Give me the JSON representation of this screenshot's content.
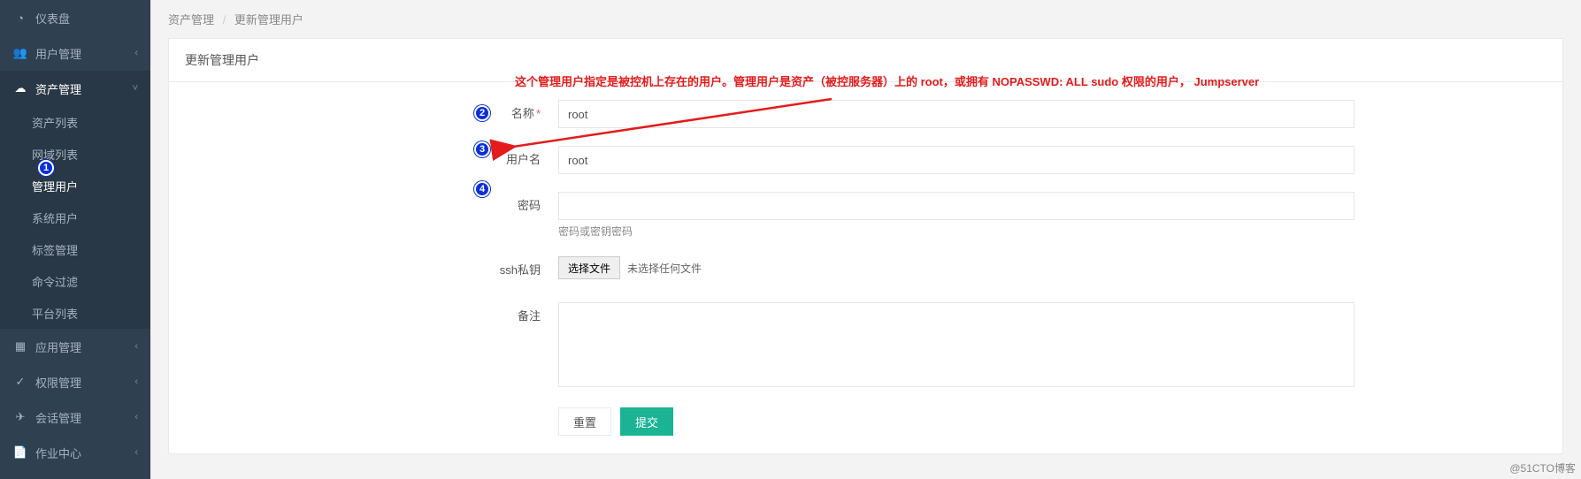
{
  "sidebar": {
    "items": [
      {
        "label": "仪表盘",
        "icon": "◔"
      },
      {
        "label": "用户管理",
        "icon": "👥",
        "chev": "‹"
      },
      {
        "label": "资产管理",
        "icon": "☁",
        "chev": "˅",
        "active": true,
        "children": [
          {
            "label": "资产列表"
          },
          {
            "label": "网域列表"
          },
          {
            "label": "管理用户",
            "active": true
          },
          {
            "label": "系统用户"
          },
          {
            "label": "标签管理"
          },
          {
            "label": "命令过滤"
          },
          {
            "label": "平台列表"
          }
        ]
      },
      {
        "label": "应用管理",
        "icon": "▦",
        "chev": "‹"
      },
      {
        "label": "权限管理",
        "icon": "✓",
        "chev": "‹"
      },
      {
        "label": "会话管理",
        "icon": "✈",
        "chev": "‹"
      },
      {
        "label": "作业中心",
        "icon": "📄",
        "chev": "‹"
      }
    ]
  },
  "breadcrumb": {
    "a": "资产管理",
    "b": "更新管理用户"
  },
  "panel": {
    "title": "更新管理用户"
  },
  "form": {
    "name_label": "名称",
    "name_value": "root",
    "user_label": "用户名",
    "user_value": "root",
    "pwd_label": "密码",
    "pwd_value": "",
    "pwd_help": "密码或密钥密码",
    "key_label": "ssh私钥",
    "key_btn": "选择文件",
    "key_nofile": "未选择任何文件",
    "note_label": "备注",
    "note_value": "",
    "reset": "重置",
    "submit": "提交"
  },
  "annotation": {
    "text": "这个管理用户指定是被控机上存在的用户。管理用户是资产（被控服务器）上的 root，或拥有 NOPASSWD: ALL sudo 权限的用户， Jumpserver",
    "badges": {
      "b1": "1",
      "b2": "2",
      "b3": "3",
      "b4": "4"
    }
  },
  "watermark": "@51CTO博客"
}
